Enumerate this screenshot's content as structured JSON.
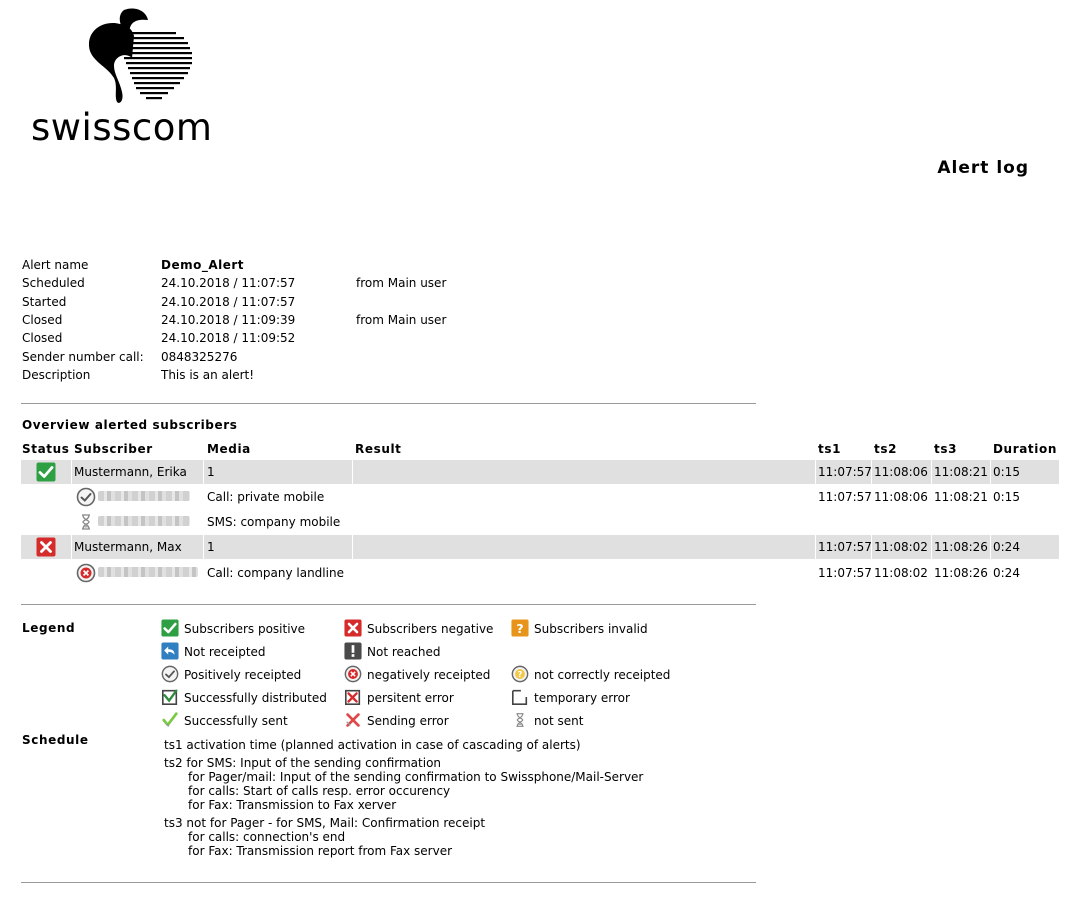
{
  "brand": {
    "name": "swisscom"
  },
  "page_title": "Alert log",
  "info": [
    {
      "label": "Alert name",
      "value": "Demo_Alert",
      "extra": ""
    },
    {
      "label": "Scheduled",
      "value": "24.10.2018 / 11:07:57",
      "extra": "from Main user"
    },
    {
      "label": "Started",
      "value": "24.10.2018 / 11:07:57",
      "extra": ""
    },
    {
      "label": "Closed",
      "value": "24.10.2018 / 11:09:39",
      "extra": "from Main user"
    },
    {
      "label": "Closed",
      "value": "24.10.2018 / 11:09:52",
      "extra": ""
    },
    {
      "label": "Sender number call:",
      "value": "0848325276",
      "extra": ""
    },
    {
      "label": "Description",
      "value": "This is an alert!",
      "extra": ""
    }
  ],
  "overview": {
    "title": "Overview alerted subscribers",
    "columns": [
      "Status",
      "Subscriber",
      "Media",
      "Result",
      "ts1",
      "ts2",
      "ts3",
      "Duration"
    ],
    "subscribers": [
      {
        "status_icon": "check-green-icon",
        "name": "Mustermann, Erika",
        "media": "1",
        "result": "",
        "ts1": "11:07:57",
        "ts2": "11:08:06",
        "ts3": "11:08:21",
        "duration": "0:15",
        "details": [
          {
            "icon": "positively-receipted-icon",
            "media": "Call: private mobile",
            "ts1": "11:07:57",
            "ts2": "11:08:06",
            "ts3": "11:08:21",
            "duration": "0:15"
          },
          {
            "icon": "hourglass-icon",
            "media": "SMS: company mobile",
            "ts1": "",
            "ts2": "",
            "ts3": "",
            "duration": ""
          }
        ]
      },
      {
        "status_icon": "cross-red-icon",
        "name": "Mustermann, Max",
        "media": "1",
        "result": "",
        "ts1": "11:07:57",
        "ts2": "11:08:02",
        "ts3": "11:08:26",
        "duration": "0:24",
        "details": [
          {
            "icon": "negatively-receipted-icon",
            "media": "Call: company landline",
            "ts1": "11:07:57",
            "ts2": "11:08:02",
            "ts3": "11:08:26",
            "duration": "0:24"
          }
        ]
      }
    ]
  },
  "legend": {
    "title": "Legend",
    "items": [
      {
        "icon": "check-green-icon",
        "label": "Subscribers positive"
      },
      {
        "icon": "cross-red-icon",
        "label": "Subscribers negative"
      },
      {
        "icon": "question-orange-icon",
        "label": "Subscribers invalid"
      },
      {
        "icon": "arrow-back-blue-icon",
        "label": "Not receipted"
      },
      {
        "icon": "exclamation-dark-icon",
        "label": "Not reached"
      },
      {
        "icon": "positively-receipted-icon",
        "label": "Positively receipted"
      },
      {
        "icon": "negatively-receipted-icon",
        "label": "negatively receipted"
      },
      {
        "icon": "not-correctly-receipted-icon",
        "label": "not correctly receipted"
      },
      {
        "icon": "distributed-icon",
        "label": "Successfully distributed"
      },
      {
        "icon": "persistent-error-icon",
        "label": "persitent error"
      },
      {
        "icon": "temporary-error-icon",
        "label": "temporary error"
      },
      {
        "icon": "sent-check-icon",
        "label": "Successfully sent"
      },
      {
        "icon": "sending-error-icon",
        "label": "Sending error"
      },
      {
        "icon": "hourglass-icon",
        "label": "not sent"
      }
    ]
  },
  "schedule": {
    "title": "Schedule",
    "lines": [
      "ts1 activation time (planned activation in case of cascading of alerts)",
      "ts2 for SMS: Input of the sending confirmation",
      "for Pager/mail: Input of the sending confirmation to Swissphone/Mail-Server",
      "for calls: Start of calls resp. error occurency",
      "for Fax: Transmission to Fax xerver",
      "ts3 not for Pager - for SMS, Mail: Confirmation receipt",
      "for calls: connection's end",
      "for Fax: Transmission report from Fax server"
    ]
  },
  "colors": {
    "row_highlight": "#e0e0e0",
    "positive": "#2ea043",
    "negative": "#d62b2b",
    "invalid": "#e8931a",
    "info": "#2f7fc1"
  }
}
